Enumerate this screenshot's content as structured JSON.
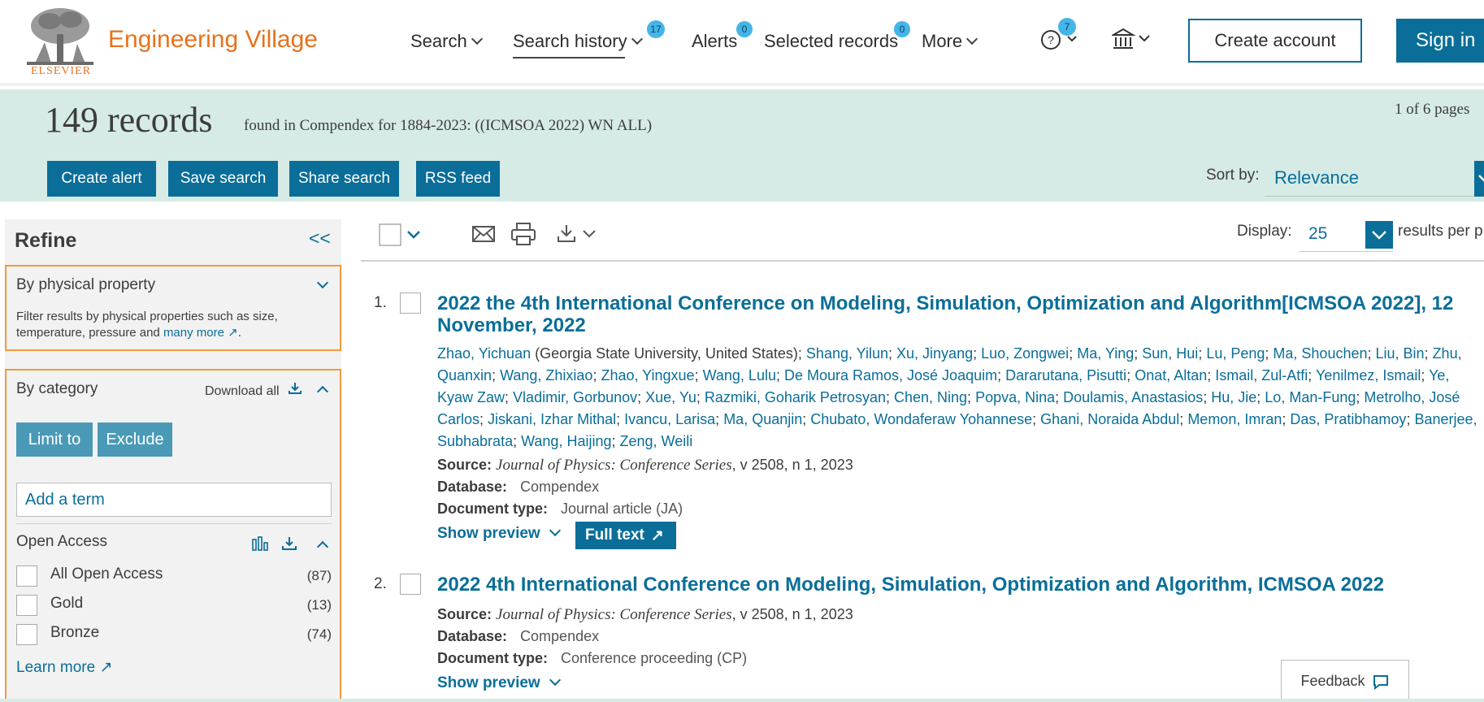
{
  "header": {
    "logo_text": "ELSEVIER",
    "brand": "Engineering Village",
    "nav": {
      "search": "Search",
      "search_history": "Search history",
      "search_history_badge": "17",
      "alerts": "Alerts",
      "alerts_badge": "0",
      "selected_records": "Selected records",
      "selected_records_badge": "0",
      "more": "More",
      "help_badge": "7"
    },
    "create_account": "Create account",
    "sign_in": "Sign in"
  },
  "band": {
    "records": "149 records",
    "query": "found in Compendex for 1884-2023: ((ICMSOA 2022) WN ALL)",
    "pages": "1 of 6 pages",
    "buttons": {
      "create_alert": "Create alert",
      "save_search": "Save search",
      "share_search": "Share search",
      "rss_feed": "RSS feed"
    },
    "sort_label": "Sort by:",
    "sort_value": "Relevance"
  },
  "sidebar": {
    "title": "Refine",
    "collapse": "<<",
    "physical": {
      "title": "By physical property",
      "desc_before": "Filter results by physical properties such as size, temperature, pressure and ",
      "desc_link": "many more",
      "desc_after": "."
    },
    "category": {
      "title": "By category",
      "download_all": "Download all",
      "limit_to": "Limit to",
      "exclude": "Exclude",
      "add_term_placeholder": "Add a term"
    },
    "open_access": {
      "title": "Open Access",
      "items": [
        {
          "label": "All Open Access",
          "count": "(87)"
        },
        {
          "label": "Gold",
          "count": "(13)"
        },
        {
          "label": "Bronze",
          "count": "(74)"
        }
      ],
      "learn_more": "Learn more"
    }
  },
  "toolbar": {
    "display_label": "Display:",
    "display_value": "25",
    "per_page": "results per p"
  },
  "results": [
    {
      "num": "1.",
      "title": "2022 the 4th International Conference on Modeling, Simulation, Optimization and Algorithm[ICMSOA 2022], 12 November, 2022",
      "first_author": "Zhao, Yichuan",
      "affiliation": " (Georgia State University, United States)",
      "authors": [
        "Shang, Yilun",
        "Xu, Jinyang",
        "Luo, Zongwei",
        "Ma, Ying",
        "Sun, Hui",
        "Lu, Peng",
        "Ma, Shouchen",
        "Liu, Bin",
        "Zhu, Quanxin",
        "Wang, Zhixiao",
        "Zhao, Yingxue",
        "Wang, Lulu",
        "De Moura Ramos, José Joaquim",
        "Dararutana, Pisutti",
        "Onat, Altan",
        "Ismail, Zul-Atfi",
        "Yenilmez, Ismail",
        "Ye, Kyaw Zaw",
        "Vladimir, Gorbunov",
        "Xue, Yu",
        "Razmiki, Goharik Petrosyan",
        "Chen, Ning",
        "Popva, Nina",
        "Doulamis, Anastasios",
        "Hu, Jie",
        "Lo, Man-Fung",
        "Metrolho, José Carlos",
        "Jiskani, Izhar Mithal",
        "Ivancu, Larisa",
        "Ma, Quanjin",
        "Chubato, Wondaferaw Yohannese",
        "Ghani, Noraida Abdul",
        "Memon, Imran",
        "Das, Pratibhamoy",
        "Banerjee, Subhabrata",
        "Wang, Haijing",
        "Zeng, Weili"
      ],
      "source_label": "Source:",
      "source_journal": "Journal of Physics: Conference Series",
      "source_detail": ", v 2508, n 1, 2023",
      "database_label": "Database:",
      "database": "Compendex",
      "doctype_label": "Document type:",
      "doctype": "Journal article (JA)",
      "show_preview": "Show preview",
      "full_text": "Full text"
    },
    {
      "num": "2.",
      "title": "2022 4th International Conference on Modeling, Simulation, Optimization and Algorithm, ICMSOA 2022",
      "source_label": "Source:",
      "source_journal": "Journal of Physics: Conference Series",
      "source_detail": ", v 2508, n 1, 2023",
      "database_label": "Database:",
      "database": "Compendex",
      "doctype_label": "Document type:",
      "doctype": "Conference proceeding (CP)",
      "show_preview": "Show preview"
    }
  ],
  "feedback": "Feedback"
}
